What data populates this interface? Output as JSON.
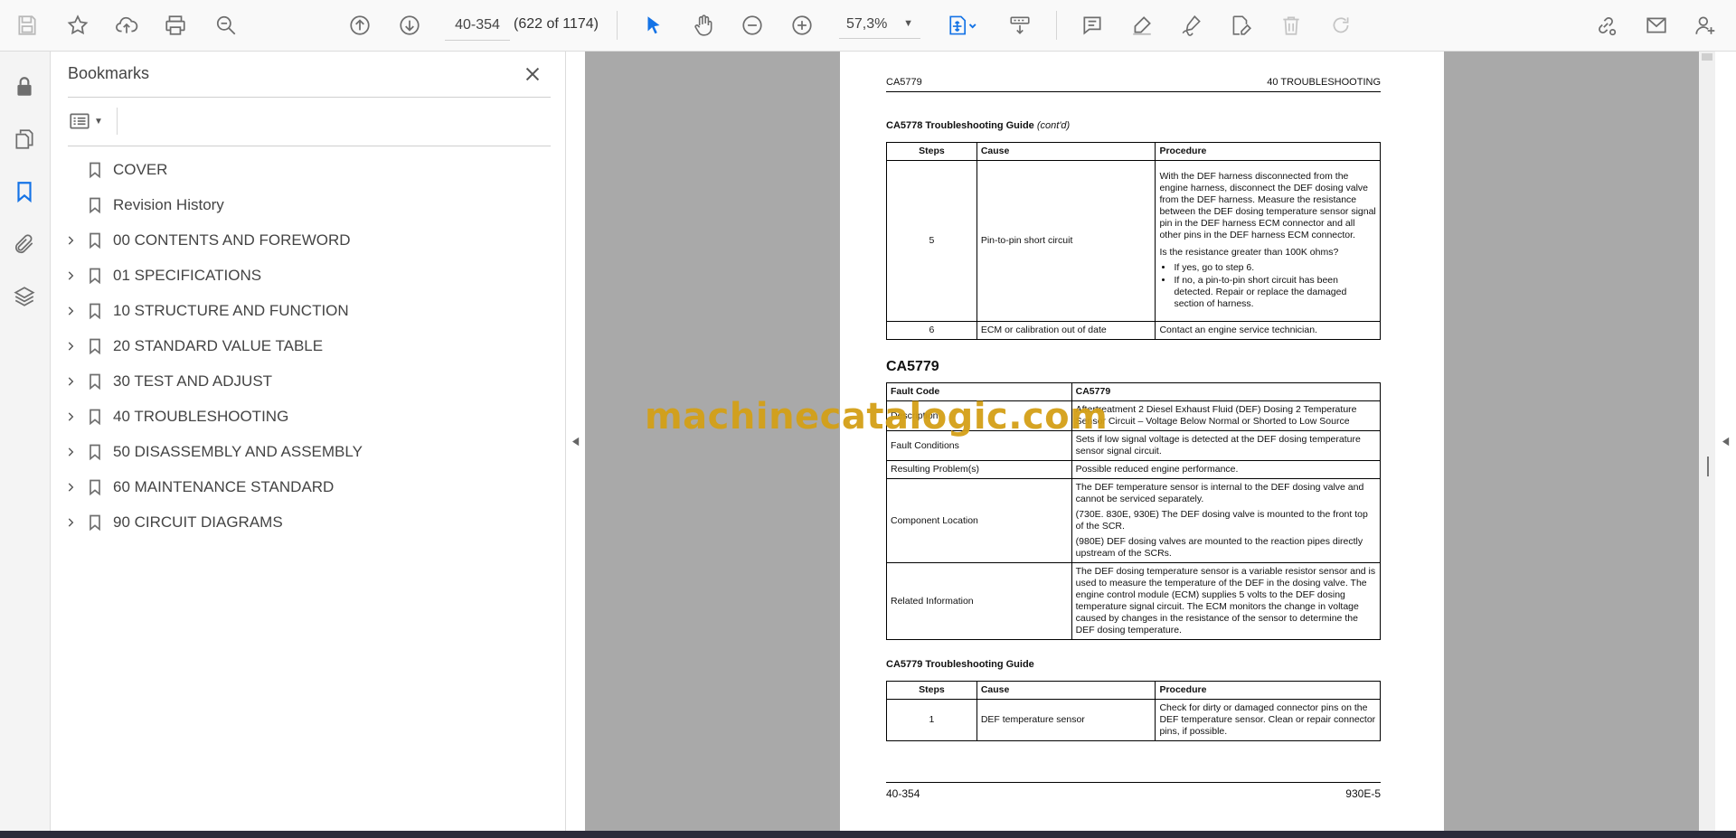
{
  "toolbar": {
    "page_value": "40-354",
    "page_count": "(622 of 1174)",
    "zoom": "57,3%"
  },
  "bookmarks": {
    "title": "Bookmarks",
    "items": [
      {
        "label": "COVER",
        "expandable": false
      },
      {
        "label": "Revision History",
        "expandable": false
      },
      {
        "label": "00 CONTENTS AND FOREWORD",
        "expandable": true
      },
      {
        "label": "01 SPECIFICATIONS",
        "expandable": true
      },
      {
        "label": "10 STRUCTURE AND FUNCTION",
        "expandable": true
      },
      {
        "label": "20 STANDARD VALUE TABLE",
        "expandable": true
      },
      {
        "label": "30 TEST AND ADJUST",
        "expandable": true
      },
      {
        "label": "40 TROUBLESHOOTING",
        "expandable": true
      },
      {
        "label": "50 DISASSEMBLY AND ASSEMBLY",
        "expandable": true
      },
      {
        "label": "60 MAINTENANCE STANDARD",
        "expandable": true
      },
      {
        "label": "90 CIRCUIT DIAGRAMS",
        "expandable": true
      }
    ]
  },
  "page": {
    "header_left": "CA5779",
    "header_right": "40 TROUBLESHOOTING",
    "guide1": {
      "caption": "CA5778 Troubleshooting Guide",
      "caption_suffix": "(cont'd)",
      "headers": [
        "Steps",
        "Cause",
        "Procedure"
      ],
      "row1": {
        "step": "5",
        "cause": "Pin-to-pin short circuit",
        "p1": "With the DEF harness disconnected from the engine harness, disconnect the DEF dosing valve from the DEF harness. Measure the resistance between the DEF dosing temperature sensor signal pin in the DEF harness ECM connector and all other pins in the DEF harness ECM connector.",
        "p2": "Is the resistance greater than 100K ohms?",
        "b1": "If yes, go to step 6.",
        "b2": "If no, a pin-to-pin short circuit has been detected. Repair or replace the damaged section of harness."
      },
      "row2": {
        "step": "6",
        "cause": "ECM or calibration out of date",
        "procedure": "Contact an engine service technician."
      }
    },
    "code_heading": "CA5779",
    "fault_table": {
      "fault_code_label": "Fault Code",
      "fault_code_value": "CA5779",
      "description_label": "Description",
      "description_value": "Aftertreatment 2 Diesel Exhaust Fluid (DEF) Dosing 2 Temperature Sensor Circuit – Voltage Below Normal or Shorted to Low Source",
      "conditions_label": "Fault Conditions",
      "conditions_value": "Sets if low signal voltage is detected at the DEF dosing temperature sensor signal circuit.",
      "problems_label": "Resulting Problem(s)",
      "problems_value": "Possible reduced engine performance.",
      "location_label": "Component Location",
      "location_p1": "The DEF temperature sensor is internal to the DEF dosing valve and cannot be serviced separately.",
      "location_p2": "(730E. 830E, 930E) The DEF dosing valve is mounted to the front top of the SCR.",
      "location_p3": "(980E) DEF dosing valves are mounted to the reaction pipes directly upstream of the SCRs.",
      "related_label": "Related Information",
      "related_value": "The DEF dosing temperature sensor is a variable resistor sensor and is used to measure the temperature of the DEF in the dosing valve. The engine control module (ECM) supplies 5 volts to the DEF dosing temperature signal circuit. The ECM monitors the change in voltage caused by changes in the resistance of the sensor to determine the DEF dosing temperature."
    },
    "guide2": {
      "caption": "CA5779 Troubleshooting Guide",
      "headers": [
        "Steps",
        "Cause",
        "Procedure"
      ],
      "row1": {
        "step": "1",
        "cause": "DEF temperature sensor",
        "procedure": "Check for dirty or damaged connector pins on the DEF temperature sensor. Clean or repair connector pins, if possible."
      }
    },
    "footer_left": "40-354",
    "footer_right": "930E-5"
  },
  "watermark": "machinecatalogic.com",
  "colors": {
    "accent_blue": "#1473e6",
    "icon_gray": "#6e6e6e",
    "watermark": "#d4a017"
  }
}
